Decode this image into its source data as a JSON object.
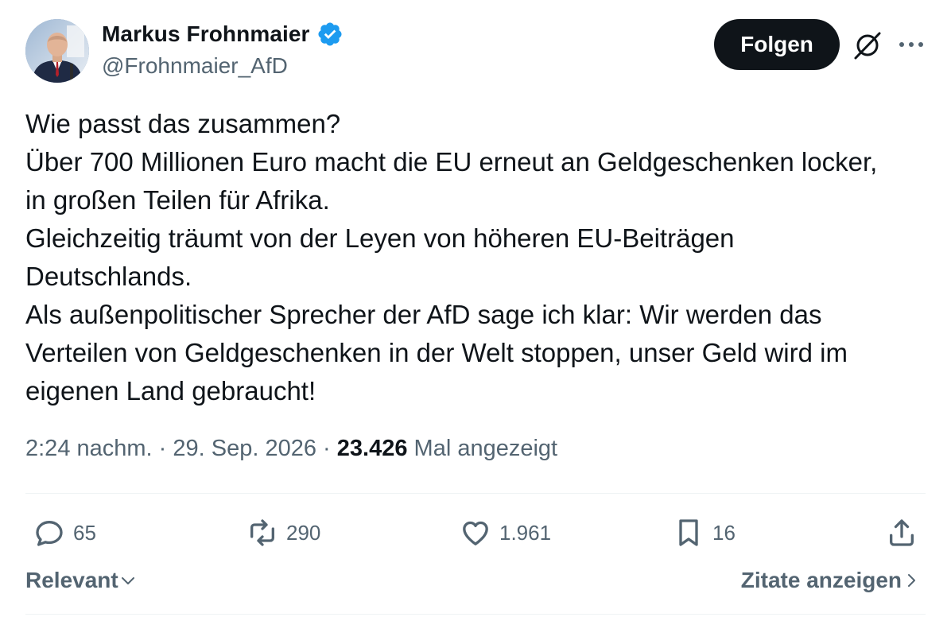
{
  "author": {
    "display_name": "Markus Frohnmaier",
    "handle": "@Frohnmaier_AfD",
    "verified_icon": "verified-badge-icon",
    "avatar_icon": "avatar-photo"
  },
  "header": {
    "follow_label": "Folgen",
    "grok_icon": "grok-icon",
    "more_icon": "more-icon"
  },
  "tweet": {
    "lines": [
      "Wie passt das zusammen?",
      "Über 700 Millionen Euro macht die EU erneut an Geldgeschenken locker,",
      "in großen Teilen für Afrika.",
      "Gleichzeitig träumt von der Leyen von höheren EU-Beiträgen",
      "Deutschlands.",
      "Als außenpolitischer Sprecher der AfD sage ich klar: Wir werden das",
      "Verteilen von Geldgeschenken in der Welt stoppen, unser Geld wird im",
      "eigenen Land gebraucht!"
    ]
  },
  "meta": {
    "time": "2:24 nachm.",
    "separator": " · ",
    "date": "29. Sep. 2026",
    "views_count": "23.426",
    "views_label": " Mal angezeigt"
  },
  "actions": {
    "replies": "65",
    "reposts": "290",
    "likes": "1.961",
    "bookmarks": "16"
  },
  "footer": {
    "sort_label": "Relevant",
    "quotes_label": "Zitate anzeigen"
  },
  "colors": {
    "text_primary": "#0f1419",
    "text_secondary": "#536471",
    "verified_blue": "#1d9bf0",
    "divider": "#eff3f4"
  }
}
